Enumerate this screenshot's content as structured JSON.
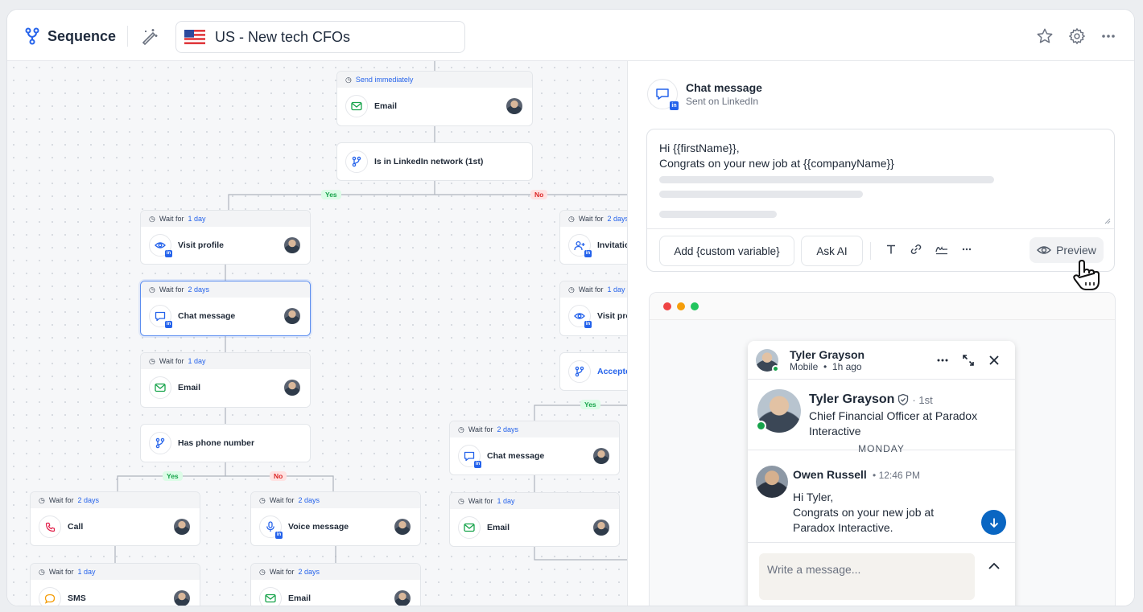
{
  "header": {
    "app_label": "Sequence",
    "sequence_title": "US - New tech CFOs",
    "icons": [
      "sequence-icon",
      "magic-wand-icon",
      "us-flag-icon",
      "star-icon",
      "gear-icon",
      "more-icon"
    ]
  },
  "canvas": {
    "nodes": {
      "top_email": {
        "wait": "Send immediately",
        "label": "Email"
      },
      "linkedin_cond": {
        "label": "Is in LinkedIn network (1st)"
      },
      "visit_profile": {
        "wait_prefix": "Wait for",
        "wait_value": "1 day",
        "label": "Visit profile"
      },
      "chat_message": {
        "wait_prefix": "Wait for",
        "wait_value": "2 days",
        "label": "Chat message"
      },
      "email_2": {
        "wait_prefix": "Wait for",
        "wait_value": "1 day",
        "label": "Email"
      },
      "phone_cond": {
        "label": "Has phone number"
      },
      "call": {
        "wait_prefix": "Wait for",
        "wait_value": "2 days",
        "label": "Call"
      },
      "sms": {
        "wait_prefix": "Wait for",
        "wait_value": "1 day",
        "label": "SMS"
      },
      "voice": {
        "wait_prefix": "Wait for",
        "wait_value": "2 days",
        "label": "Voice message"
      },
      "email_3": {
        "wait_prefix": "Wait for",
        "wait_value": "2 days",
        "label": "Email"
      },
      "invitation": {
        "wait_prefix": "Wait for",
        "wait_value": "2 days",
        "label": "Invitatio"
      },
      "visit_pro": {
        "wait_prefix": "Wait for",
        "wait_value": "1 day",
        "label": "Visit pro"
      },
      "accepted": {
        "label": "Accepte"
      },
      "chat_message_2": {
        "wait_prefix": "Wait for",
        "wait_value": "2 days",
        "label": "Chat message"
      },
      "email_4": {
        "wait_prefix": "Wait for",
        "wait_value": "1 day",
        "label": "Email"
      }
    },
    "branch_yes": "Yes",
    "branch_no": "No"
  },
  "panel": {
    "title": "Chat message",
    "subtitle": "Sent on LinkedIn",
    "message_line1": "Hi {{firstName}},",
    "message_line2": "Congrats on your new job at {{companyName}}",
    "btn_custom_var": "Add {custom variable}",
    "btn_ask_ai": "Ask AI",
    "btn_preview": "Preview"
  },
  "preview": {
    "header_name": "Tyler Grayson",
    "header_device": "Mobile",
    "header_time": "1h ago",
    "profile_name": "Tyler Grayson",
    "profile_degree": "1st",
    "profile_title": "Chief Financial Officer at Paradox Interactive",
    "day_label": "MONDAY",
    "sender_name": "Owen Russell",
    "sender_time": "12:46 PM",
    "msg_line1": "Hi Tyler,",
    "msg_line2": "Congrats on your new job at",
    "msg_line3": "Paradox Interactive.",
    "input_placeholder": "Write a message..."
  },
  "colors": {
    "accent_blue": "#2563eb",
    "yes_green": "#16a34a",
    "no_red": "#dc2626",
    "dot_red": "#ef4444",
    "dot_yellow": "#f59e0b",
    "dot_green": "#22c55e"
  }
}
